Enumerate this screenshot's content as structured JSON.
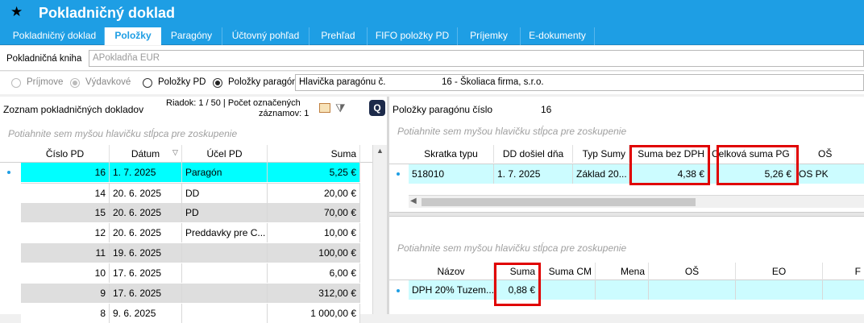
{
  "window": {
    "title": "Pokladničný doklad"
  },
  "tabs": [
    "Pokladničný doklad",
    "Položky",
    "Paragóny",
    "Účtovný pohľad",
    "Prehľad",
    "FIFO položky PD",
    "Príjemky",
    "E-dokumenty"
  ],
  "book": {
    "label": "Pokladničná kniha",
    "value": "APokladňa EUR"
  },
  "radios": {
    "prijmove": "Príjmove",
    "vydavkove": "Výdavkové",
    "polozky_pd": "Položky PD",
    "polozky_paragonu": "Položky paragónu",
    "header_label": "Hlavička paragónu č.",
    "header_value": "16 - Školiaca firma, s.r.o."
  },
  "left": {
    "title": "Zoznam pokladničných dokladov",
    "status1": "Riadok: 1 / 50 | Počet označených",
    "status2": "záznamov: 1",
    "group_hint": "Potiahnite sem myšou hlavičku stĺpca pre zoskupenie",
    "columns": [
      "Číslo PD",
      "Dátum",
      "Účel PD",
      "Suma"
    ],
    "rows": [
      [
        "16",
        "1. 7. 2025",
        "Paragón",
        "5,25 €"
      ],
      [
        "14",
        "20. 6. 2025",
        "DD",
        "20,00 €"
      ],
      [
        "15",
        "20. 6. 2025",
        "PD",
        "70,00 €"
      ],
      [
        "12",
        "20. 6. 2025",
        "Preddavky pre C...",
        "10,00 €"
      ],
      [
        "11",
        "19. 6. 2025",
        "",
        "100,00 €"
      ],
      [
        "10",
        "17. 6. 2025",
        "",
        "6,00 €"
      ],
      [
        "9",
        "17. 6. 2025",
        "",
        "312,00 €"
      ],
      [
        "8",
        "9. 6. 2025",
        "",
        "1 000,00 €"
      ]
    ]
  },
  "right": {
    "title": "Položky paragónu číslo",
    "number": "16",
    "group_hint": "Potiahnite sem myšou hlavičku stĺpca pre zoskupenie",
    "top_columns": [
      "Skratka typu",
      "DD došiel dňa",
      "Typ Sumy",
      "Suma bez DPH",
      "Celková suma PG",
      "OŠ"
    ],
    "top_row": [
      "518010",
      "1. 7. 2025",
      "Základ 20...",
      "4,38 €",
      "5,26 €",
      "OS PK"
    ],
    "bottom_group_hint": "Potiahnite sem myšou hlavičku stĺpca pre zoskupenie",
    "bottom_columns": [
      "Názov",
      "Suma",
      "Suma CM",
      "Mena",
      "OŠ",
      "EO",
      "F"
    ],
    "bottom_row": [
      "DPH 20% Tuzem...",
      "0,88 €",
      "",
      "",
      "",
      "",
      ""
    ]
  },
  "colors": {
    "accent": "#1e9ee4",
    "selected_row": "#00ffff",
    "highlight": "#e00000"
  }
}
